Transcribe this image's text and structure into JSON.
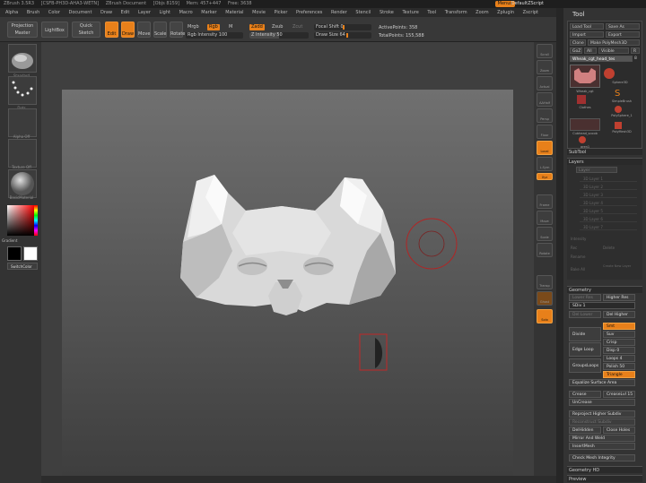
{
  "titlebar": {
    "items": [
      "ZBrush 3.5R3",
      "[CSFB-PH3D-AHA3-WETN]",
      "ZBrush Document",
      "[Objs 8159]",
      "Mem: 457+447",
      "Free: 3638"
    ],
    "menus": "Menus",
    "script": "DefaultZScript"
  },
  "menubar": [
    "Alpha",
    "Brush",
    "Color",
    "Document",
    "Draw",
    "Edit",
    "Layer",
    "Light",
    "Macro",
    "Marker",
    "Material",
    "Movie",
    "Picker",
    "Preferences",
    "Render",
    "Stencil",
    "Stroke",
    "Texture",
    "Tool",
    "Transform",
    "Zoom",
    "Zplugin",
    "Zscript"
  ],
  "toolbar": {
    "projection_master": "Projection Master",
    "lightbox": "LightBox",
    "quick_sketch": "Quick Sketch",
    "edit": "Edit",
    "draw": "Draw",
    "move": "Move",
    "scale": "Scale",
    "rotate": "Rotate",
    "mrgb": "Mrgb",
    "rgb": "Rgb",
    "m": "M",
    "rgb_intensity": "Rgb Intensity 100",
    "zadd": "Zadd",
    "zsub": "Zsub",
    "zcut": "Zcut",
    "z_intensity": "Z Intensity 50",
    "focal_shift": "Focal Shift 0",
    "draw_size": "Draw Size 64",
    "active_points": "ActivePoints: 358",
    "total_points": "TotalPoints: 155,588"
  },
  "leftshelf": {
    "labels": [
      "Standard",
      "Dots",
      "Alpha Off",
      "Texture Off",
      "BasicMaterial"
    ],
    "gradient": "Gradient",
    "switchcolor": "SwitchColor"
  },
  "rightshelf": [
    "Scroll",
    "Zoom",
    "Actual",
    "AAHalf",
    "Persp",
    "Floor",
    "Local",
    "L.Sym",
    "Xyz",
    "Frame",
    "Move",
    "Scale",
    "Rotate",
    "Transp",
    "Ghost",
    "Solo",
    "Xpose"
  ],
  "toolpanel": {
    "title": "Tool",
    "load": "Load Tool",
    "save": "Save As",
    "import": "Import",
    "export": "Export",
    "clone": "Clone",
    "make_polymesh": "Make PolyMesh3D",
    "goz": "GoZ",
    "all": "All",
    "visible": "Visible",
    "r": "R",
    "current": "Wheak_cgt_head_tes",
    "current_count": "8",
    "tools": [
      "Wheak_cgt",
      "Sphere3D",
      "Cylinder3D",
      "SimpleBrush",
      "Clothes",
      "PolySphere_1",
      "Cubhead_scoob",
      "PolyMesh3D",
      "aren1"
    ],
    "subtool": "SubTool",
    "layers": "Layers",
    "layer_name": "Layer",
    "layer_items": [
      "3D Layer 1",
      "3D Layer 2",
      "3D Layer 3",
      "3D Layer 4",
      "3D Layer 5",
      "3D Layer 6",
      "3D Layer 7"
    ],
    "intensity": "Intensity",
    "rec": "Rec",
    "delete": "Delete",
    "rename": "Rename",
    "bake_all": "Bake All",
    "create_layer": "Create New Layer",
    "geometry": "Geometry",
    "lower_res": "Lower Res",
    "higher_res": "Higher Res",
    "sdiv": "SDiv 1",
    "reconstruct": "Reconstruct Subdiv",
    "del_lower": "Del Lower",
    "del_higher": "Del Higher",
    "smt": "Smt",
    "suv": "Suv",
    "divide": "Divide",
    "crisp": "Crisp",
    "disp": "Disp 0",
    "edge_loop": "Edge Loop",
    "loops": "Loops 4",
    "groups_loops": "GroupsLoops",
    "polish": "Polish 50",
    "triangle": "Triangle",
    "equalize": "Equalize Surface Area",
    "crease": "Crease",
    "creaselvl": "CreaseLvl 15",
    "uncrease": "UnCrease",
    "reproject": "Reproject Higher Subdiv",
    "reconstruct2": "Reconstruct Subdiv",
    "unhidden": "DelHidden",
    "close_holes": "Close Holes",
    "mirror_weld": "Mirror And Weld",
    "insert_mesh": "InsertMesh",
    "check_mesh": "Check Mesh Integrity",
    "geometry_hd": "Geometry HD",
    "preview": "Preview"
  },
  "colors": {
    "accent": "#e8801a",
    "brush_ring": "#b32424"
  }
}
